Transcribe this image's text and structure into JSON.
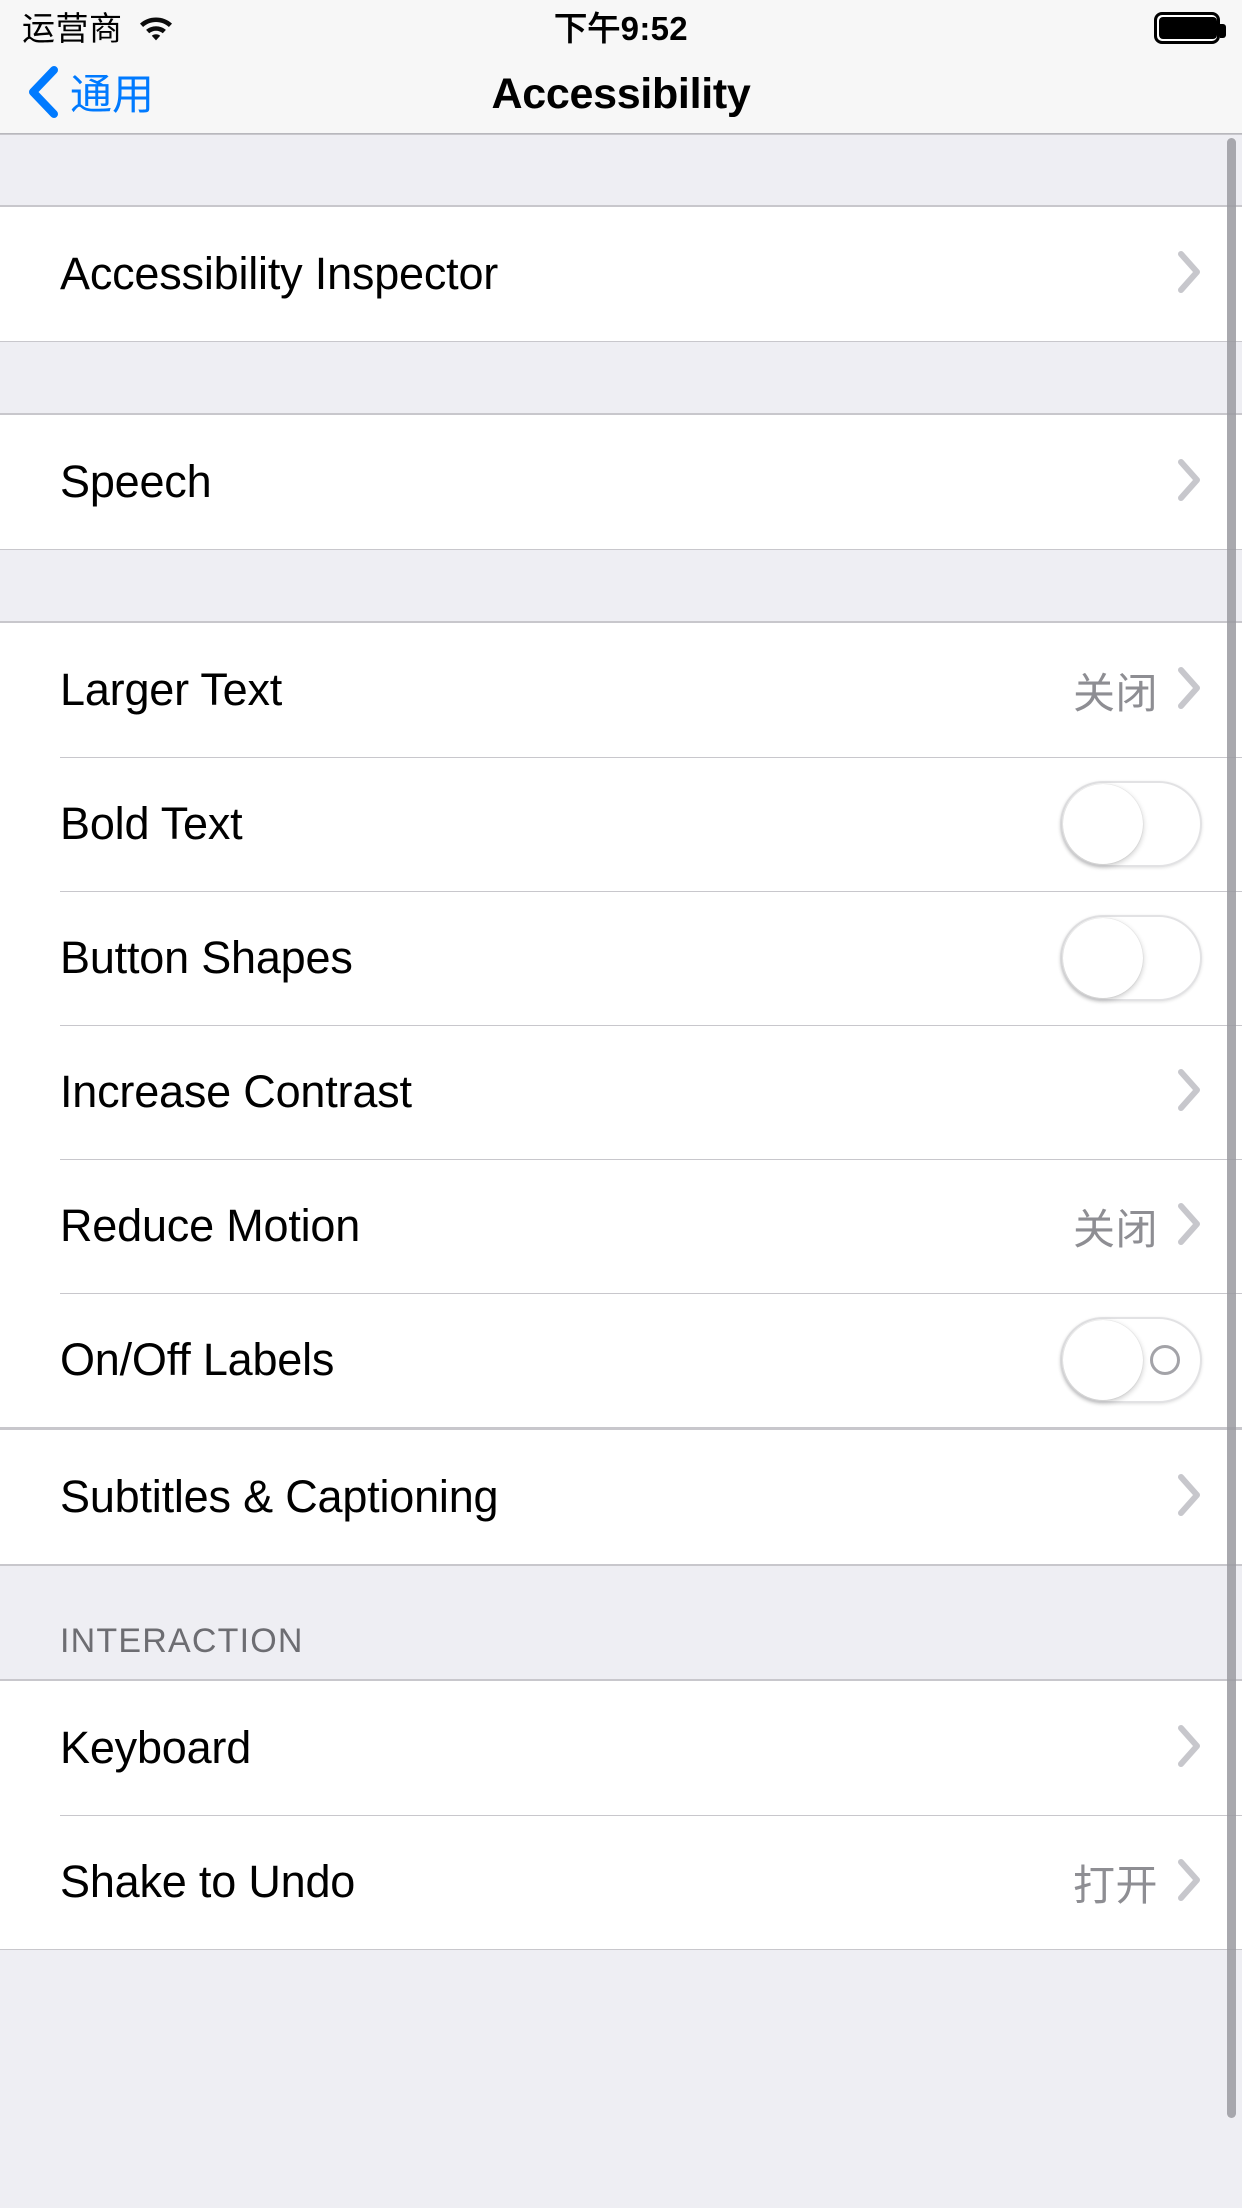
{
  "status_bar": {
    "carrier": "运营商",
    "wifi_icon": "wifi-icon",
    "time": "下午9:52",
    "battery_icon": "battery-full-icon",
    "battery_level": 100
  },
  "nav_bar": {
    "back_label": "通用",
    "back_icon": "chevron-left-icon",
    "title": "Accessibility"
  },
  "colors": {
    "accent": "#007aff",
    "group_background": "#eeeef3",
    "row_background": "#ffffff",
    "separator": "#c8c7cc",
    "secondary_text": "#8e8e93",
    "header_text": "#6d6d72"
  },
  "sections": [
    {
      "header": "",
      "rows": [
        {
          "label": "Accessibility Inspector",
          "value": "",
          "accessory": "chevron",
          "name": "accessibility-inspector"
        }
      ]
    },
    {
      "header": "",
      "rows": [
        {
          "label": "Speech",
          "value": "",
          "accessory": "chevron",
          "name": "speech"
        }
      ]
    },
    {
      "header": "",
      "rows": [
        {
          "label": "Larger Text",
          "value": "关闭",
          "accessory": "chevron",
          "name": "larger-text"
        },
        {
          "label": "Bold Text",
          "value": "",
          "accessory": "switch",
          "switch_on": false,
          "switch_style": "plain",
          "name": "bold-text"
        },
        {
          "label": "Button Shapes",
          "value": "",
          "accessory": "switch",
          "switch_on": false,
          "switch_style": "plain",
          "name": "button-shapes"
        },
        {
          "label": "Increase Contrast",
          "value": "",
          "accessory": "chevron",
          "name": "increase-contrast"
        },
        {
          "label": "Reduce Motion",
          "value": "关闭",
          "accessory": "chevron",
          "name": "reduce-motion"
        },
        {
          "label": "On/Off Labels",
          "value": "",
          "accessory": "switch",
          "switch_on": false,
          "switch_style": "labeled",
          "name": "on-off-labels"
        }
      ]
    },
    {
      "header": "",
      "rows": [
        {
          "label": "Subtitles & Captioning",
          "value": "",
          "accessory": "chevron",
          "name": "subtitles-captioning"
        }
      ]
    },
    {
      "header": "INTERACTION",
      "rows": [
        {
          "label": "Keyboard",
          "value": "",
          "accessory": "chevron",
          "name": "keyboard"
        },
        {
          "label": "Shake to Undo",
          "value": "打开",
          "accessory": "chevron",
          "name": "shake-to-undo"
        }
      ]
    }
  ]
}
